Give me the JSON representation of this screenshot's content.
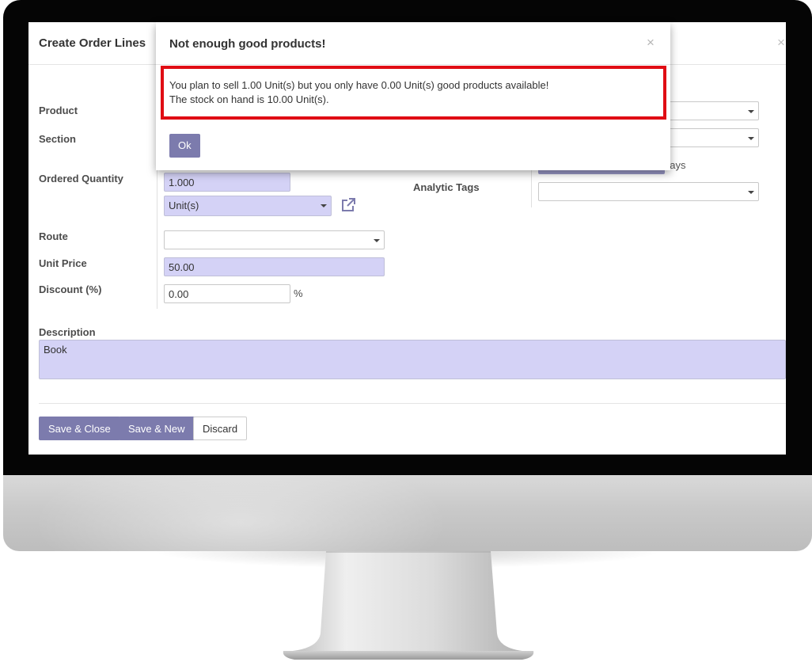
{
  "form": {
    "title": "Create Order Lines",
    "close_glyph": "×",
    "fields": {
      "product_label": "Product",
      "section_label": "Section",
      "ordered_quantity_label": "Ordered Quantity",
      "ordered_quantity_value": "1.000",
      "uom_value": "Unit(s)",
      "route_label": "Route",
      "route_value": "",
      "unit_price_label": "Unit Price",
      "unit_price_value": "50.00",
      "discount_label": "Discount (%)",
      "discount_value": "0.00",
      "discount_suffix": "%",
      "analytic_tags_label": "Analytic Tags",
      "analytic_tags_value": "",
      "lead_time_suffix": "days",
      "description_label": "Description",
      "description_value": "Book"
    },
    "buttons": {
      "save_close": "Save & Close",
      "save_new": "Save & New",
      "discard": "Discard"
    }
  },
  "dialog": {
    "title": "Not enough good products!",
    "close_glyph": "×",
    "message_line1": "You plan to sell 1.00 Unit(s) but you only have 0.00 Unit(s) good products available!",
    "message_line2": "The stock on hand is 10.00 Unit(s).",
    "ok_label": "Ok",
    "highlight_color": "#e00d14"
  },
  "icons": {
    "external_link": "external-link-icon",
    "dropdown": "chevron-down-icon"
  },
  "colors": {
    "primary": "#7c7bad",
    "required_field_bg": "#d4d2f6"
  }
}
